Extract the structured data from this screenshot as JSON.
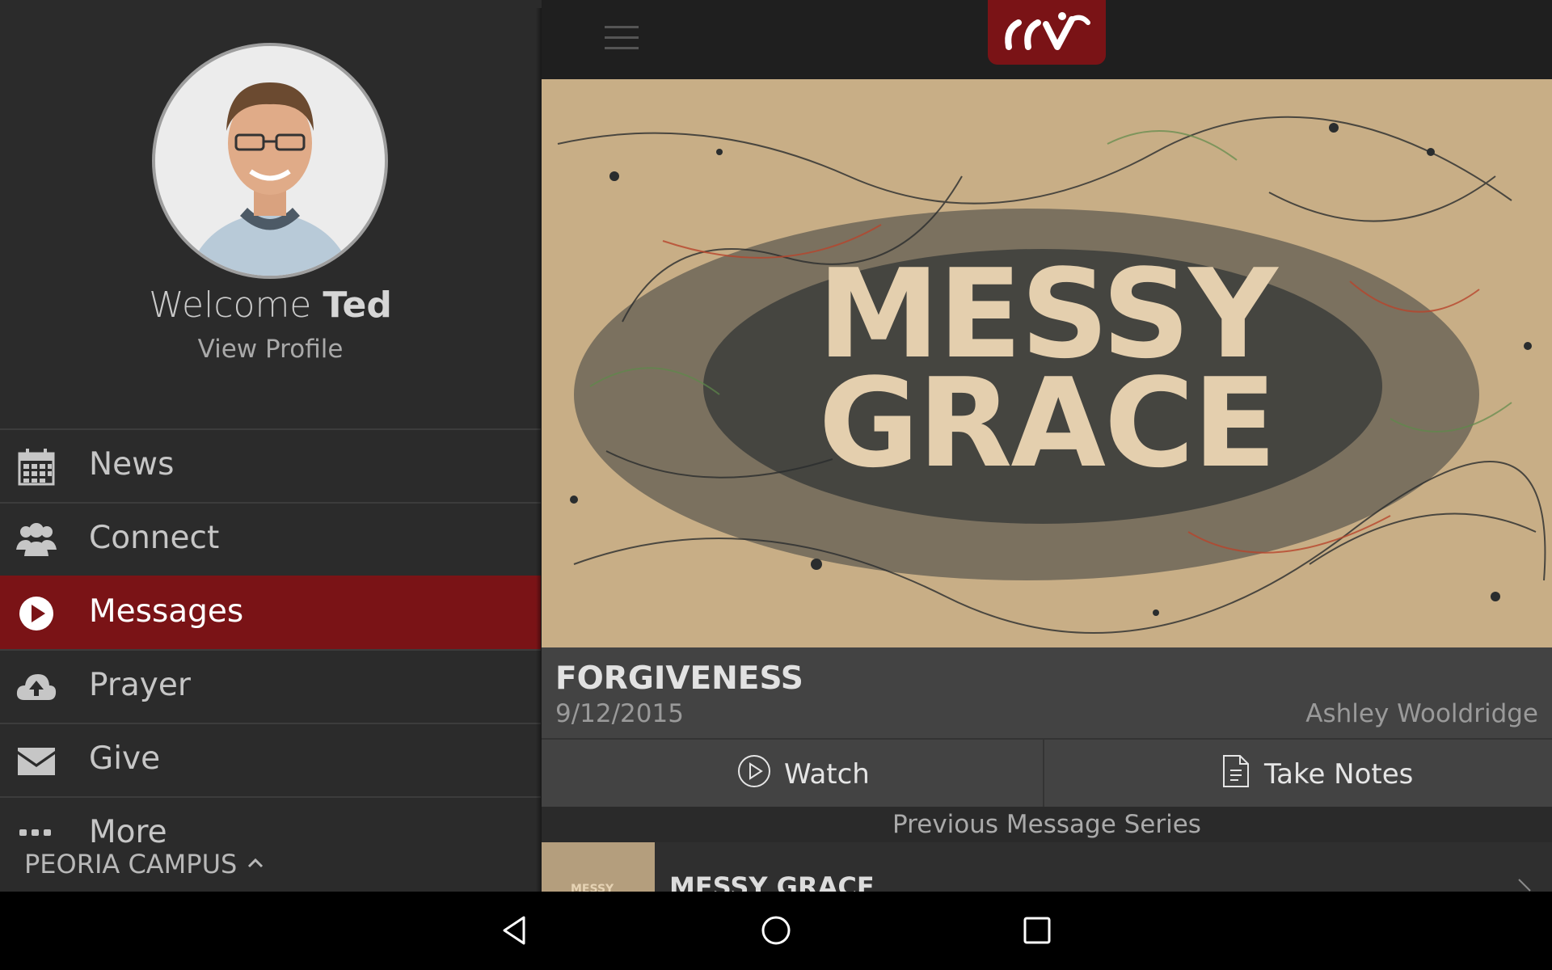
{
  "sidebar": {
    "welcome_prefix": "Welcome",
    "user_name": "Ted",
    "view_profile": "View Profile",
    "items": [
      {
        "label": "News",
        "icon": "calendar-icon",
        "active": false
      },
      {
        "label": "Connect",
        "icon": "people-icon",
        "active": false
      },
      {
        "label": "Messages",
        "icon": "play-circle-icon",
        "active": true
      },
      {
        "label": "Prayer",
        "icon": "cloud-upload-icon",
        "active": false
      },
      {
        "label": "Give",
        "icon": "envelope-icon",
        "active": false
      },
      {
        "label": "More",
        "icon": "more-dots-icon",
        "active": false
      }
    ],
    "campus": "PEORIA CAMPUS"
  },
  "header": {
    "logo_text": "ccv",
    "menu_icon": "hamburger-icon"
  },
  "banner": {
    "line1": "MESSY",
    "line2": "GRACE"
  },
  "message": {
    "title": "FORGIVENESS",
    "date": "9/12/2015",
    "speaker": "Ashley Wooldridge"
  },
  "actions": {
    "watch_label": "Watch",
    "notes_label": "Take Notes"
  },
  "previous": {
    "header": "Previous Message Series",
    "items": [
      {
        "title": "MESSY GRACE",
        "thumb_text": "MESSY"
      }
    ]
  },
  "colors": {
    "accent": "#7a1316",
    "sidebar_bg": "#2b2b2b",
    "info_bg": "#434343"
  }
}
